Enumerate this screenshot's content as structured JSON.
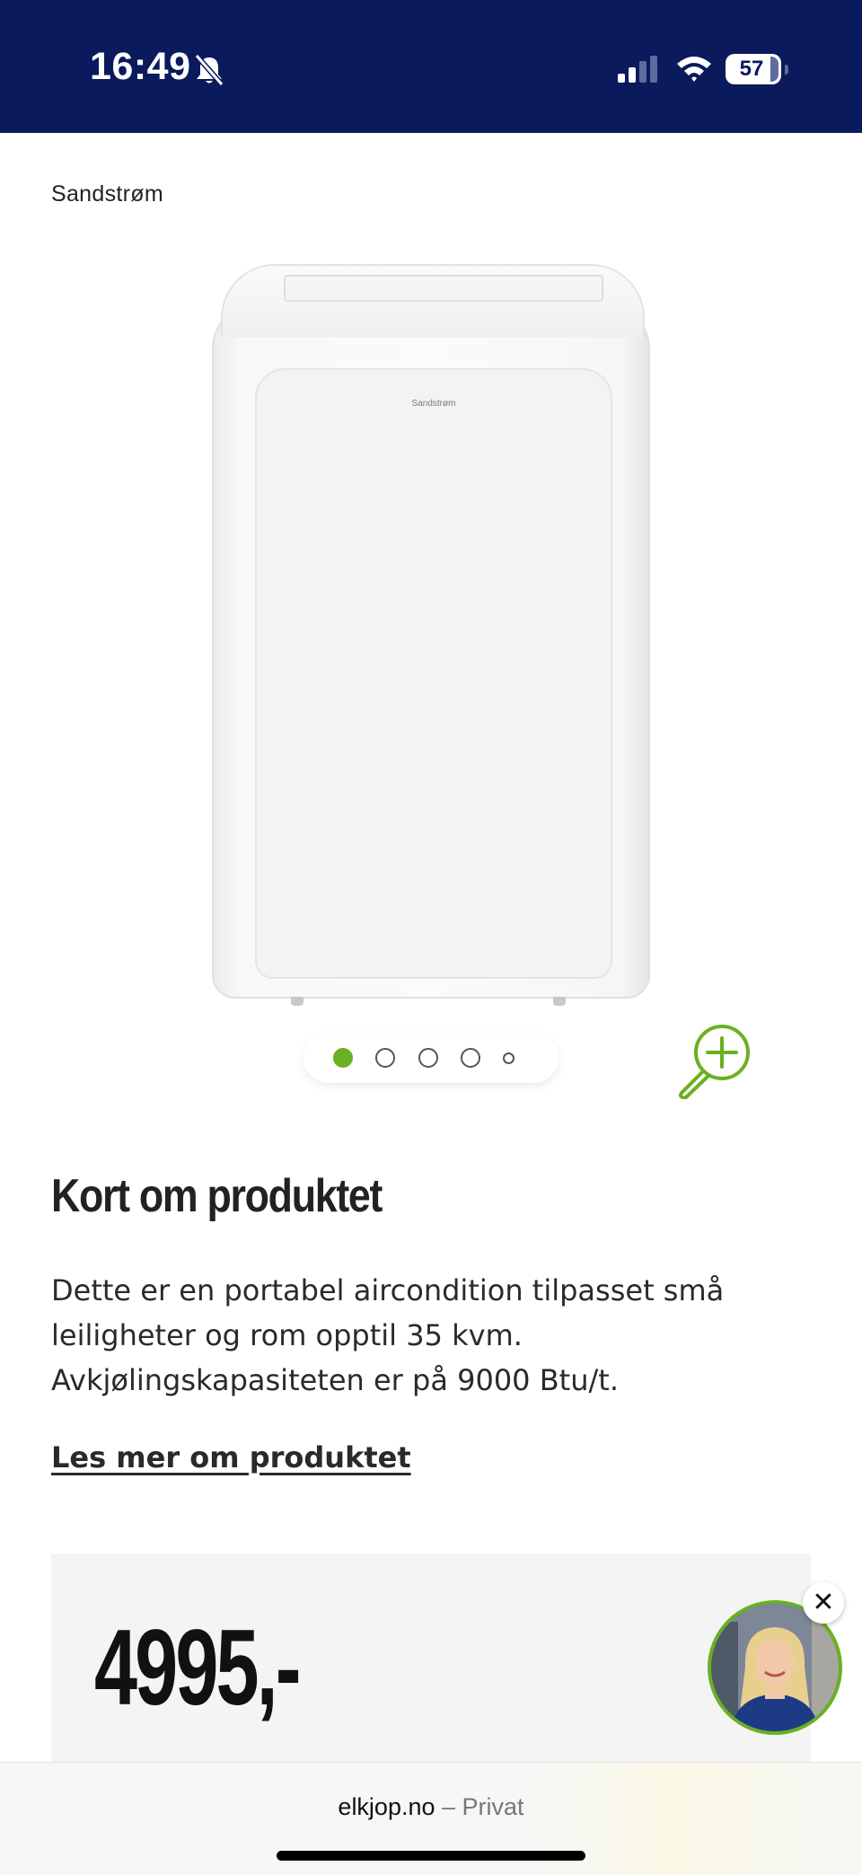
{
  "status_bar": {
    "time": "16:49",
    "battery_level": "57",
    "icons": [
      "bell-muted-icon",
      "signal-icon",
      "wifi-icon",
      "battery-icon"
    ]
  },
  "product": {
    "brand": "Sandstrøm",
    "image_logo_text": "Sandstrøm",
    "gallery": {
      "total_images": 5,
      "active_index": 0
    }
  },
  "about": {
    "title": "Kort om produktet",
    "description": "Dette er en portabel aircondition tilpasset små leiligheter og rom opptil 35 kvm. Avkjølingskapasiteten er på 9000 Btu/t.",
    "read_more_label": "Les mer om produktet"
  },
  "price": {
    "amount": "4995,-"
  },
  "chat": {
    "close_symbol": "✕"
  },
  "browser": {
    "domain": "elkjop.no",
    "separator": " – ",
    "mode": "Privat"
  },
  "colors": {
    "header_bg": "#0a1a5c",
    "accent_green": "#6ab023",
    "price_bg": "#f4f4f4"
  }
}
